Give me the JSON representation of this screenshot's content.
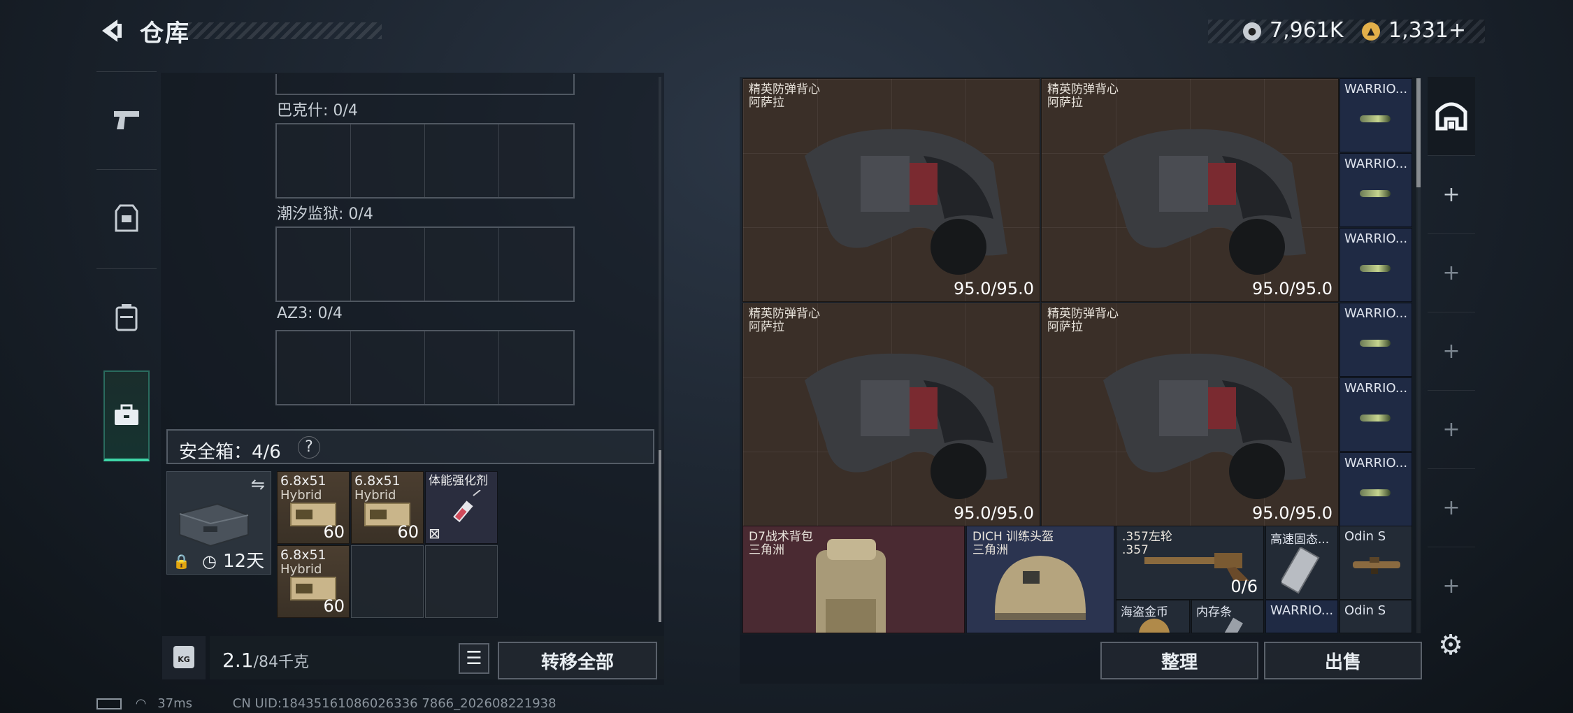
{
  "header": {
    "title": "仓库"
  },
  "currency": {
    "primary": "7,961K",
    "secondary": "1,331+"
  },
  "tabs": [
    {
      "icon": "pistol-icon"
    },
    {
      "icon": "armor-icon"
    },
    {
      "icon": "backpack-icon"
    },
    {
      "icon": "toolbox-icon",
      "active": true
    }
  ],
  "sections": [
    {
      "label": "巴克什: 0/4"
    },
    {
      "label": "潮汐监狱: 0/4"
    },
    {
      "label": "AZ3: 0/4"
    }
  ],
  "safe": {
    "title": "安全箱：4/6",
    "help": "?",
    "timer": "12天",
    "slots": [
      {
        "name": "6.8x51",
        "sub": "Hybrid",
        "count": "60"
      },
      {
        "name": "6.8x51",
        "sub": "Hybrid",
        "count": "60"
      },
      {
        "name": "体能强化剂",
        "sub": "",
        "count": ""
      },
      {
        "name": "6.8x51",
        "sub": "Hybrid",
        "count": "60"
      }
    ]
  },
  "weight": {
    "value": "2.1",
    "unit": "/84千克",
    "lock": "KG"
  },
  "buttons": {
    "transfer_all": "转移全部",
    "sort": "整理",
    "sell": "出售"
  },
  "vests": [
    {
      "name": "精英防弹背心",
      "map": "阿萨拉",
      "durability": "95.0/95.0"
    },
    {
      "name": "精英防弹背心",
      "map": "阿萨拉",
      "durability": "95.0/95.0"
    },
    {
      "name": "精英防弹背心",
      "map": "阿萨拉",
      "durability": "95.0/95.0"
    },
    {
      "name": "精英防弹背心",
      "map": "阿萨拉",
      "durability": "95.0/95.0"
    }
  ],
  "warrior_col": [
    "WARRIO...",
    "WARRIO...",
    "WARRIO...",
    "WARRIO...",
    "WARRIO...",
    "WARRIO..."
  ],
  "bottom_items": [
    {
      "name": "D7战术背包",
      "map": "三角洲"
    },
    {
      "name": "DICH 训练头盔",
      "map": "三角洲"
    },
    {
      "name": ".357左轮",
      "sub": ".357",
      "count": "0/6"
    },
    {
      "name": "高速固态..."
    },
    {
      "name": "Odin S"
    },
    {
      "name": "海盗金币"
    },
    {
      "name": "内存条"
    },
    {
      "name": "WARRIO..."
    },
    {
      "name": "Odin S"
    }
  ],
  "status": {
    "ping": "37ms",
    "uid": "CN UID:18435161086026336 7866_202608221938"
  }
}
